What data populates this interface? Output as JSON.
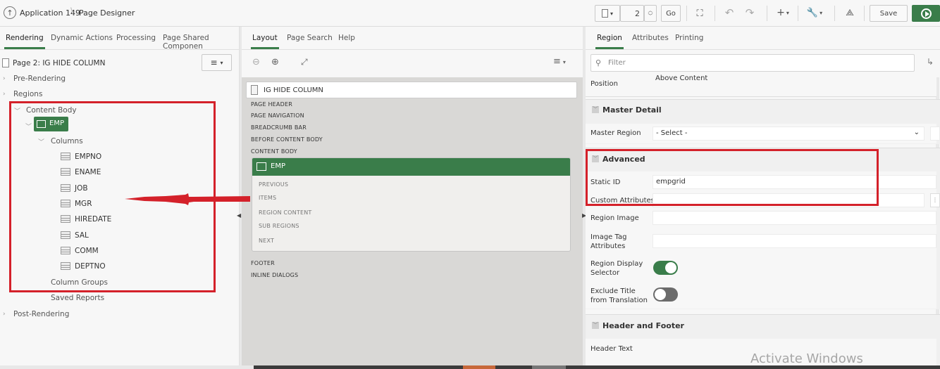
{
  "header": {
    "app_label": "Application 149",
    "page_label": "Page Designer",
    "page_number": "2",
    "go_label": "Go",
    "save_label": "Save"
  },
  "left_panel": {
    "tabs": [
      "Rendering",
      "Dynamic Actions",
      "Processing",
      "Page Shared Componen"
    ],
    "page_title": "Page 2: IG HIDE COLUMN",
    "pre_rendering": "Pre-Rendering",
    "regions": "Regions",
    "content_body": "Content Body",
    "region_name": "EMP",
    "columns_label": "Columns",
    "columns": [
      "EMPNO",
      "ENAME",
      "JOB",
      "MGR",
      "HIREDATE",
      "SAL",
      "COMM",
      "DEPTNO"
    ],
    "column_groups": "Column Groups",
    "saved_reports": "Saved Reports",
    "post_rendering": "Post-Rendering"
  },
  "middle_panel": {
    "tabs": [
      "Layout",
      "Page Search",
      "Help"
    ],
    "page_title": "IG HIDE COLUMN",
    "positions": [
      "PAGE HEADER",
      "PAGE NAVIGATION",
      "BREADCRUMB BAR",
      "BEFORE CONTENT BODY",
      "CONTENT BODY"
    ],
    "region_name": "EMP",
    "region_slots": [
      "PREVIOUS",
      "ITEMS",
      "REGION CONTENT",
      "SUB REGIONS",
      "NEXT"
    ],
    "bottom_positions": [
      "FOOTER",
      "INLINE DIALOGS"
    ]
  },
  "right_panel": {
    "tabs": [
      "Region",
      "Attributes",
      "Printing"
    ],
    "filter_placeholder": "Filter",
    "position_label": "Position",
    "position_value": "Above Content",
    "master_detail": {
      "title": "Master Detail",
      "master_region_label": "Master Region",
      "master_region_value": "- Select -"
    },
    "advanced": {
      "title": "Advanced",
      "static_id_label": "Static ID",
      "static_id_value": "empgrid",
      "custom_attributes_label": "Custom Attributes",
      "region_image_label": "Region Image",
      "image_tag_label": "Image Tag Attributes",
      "display_selector_label": "Region Display Selector",
      "display_selector_on": true,
      "exclude_title_label": "Exclude Title from Translation",
      "exclude_title_on": false
    },
    "header_footer": {
      "title": "Header and Footer",
      "header_text_label": "Header Text"
    }
  },
  "watermark": "Activate Windows",
  "colors": {
    "accent_green": "#3a7d4a",
    "annotation_red": "#d4212a"
  }
}
